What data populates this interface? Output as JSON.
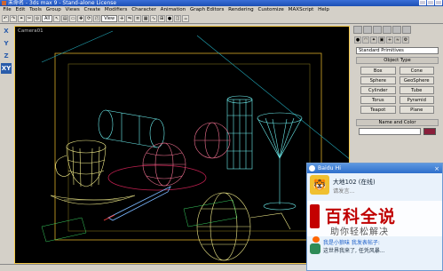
{
  "window": {
    "title": "未命名 - 3ds max 9 - Stand-alone License"
  },
  "menu": [
    "File",
    "Edit",
    "Tools",
    "Group",
    "Views",
    "Create",
    "Modifiers",
    "Character",
    "Animation",
    "Graph Editors",
    "Rendering",
    "Customize",
    "MAXScript",
    "Help"
  ],
  "toolbar": {
    "filter_value": "All",
    "view_value": "View"
  },
  "left_tools": [
    "X",
    "Y",
    "Z",
    "XY"
  ],
  "viewport": {
    "label": "Camera01"
  },
  "panel": {
    "category_value": "Standard Primitives",
    "object_type_title": "Object Type",
    "primitives": [
      "Box",
      "Cone",
      "Sphere",
      "GeoSphere",
      "Cylinder",
      "Tube",
      "Torus",
      "Pyramid",
      "Teapot",
      "Plane"
    ],
    "name_color_title": "Name and Color",
    "color": "#8a1f3b"
  },
  "baidu_hi": {
    "title": "Baidu Hi",
    "user_name": "大地102 (在线)",
    "user_status": "请发言...",
    "ad_big": "百科全说",
    "ad_sub": "助你轻松解决",
    "msg1": "我是小狼味 我发表帖子:",
    "msg2": "这世界我来了, 任凭风暴..."
  }
}
